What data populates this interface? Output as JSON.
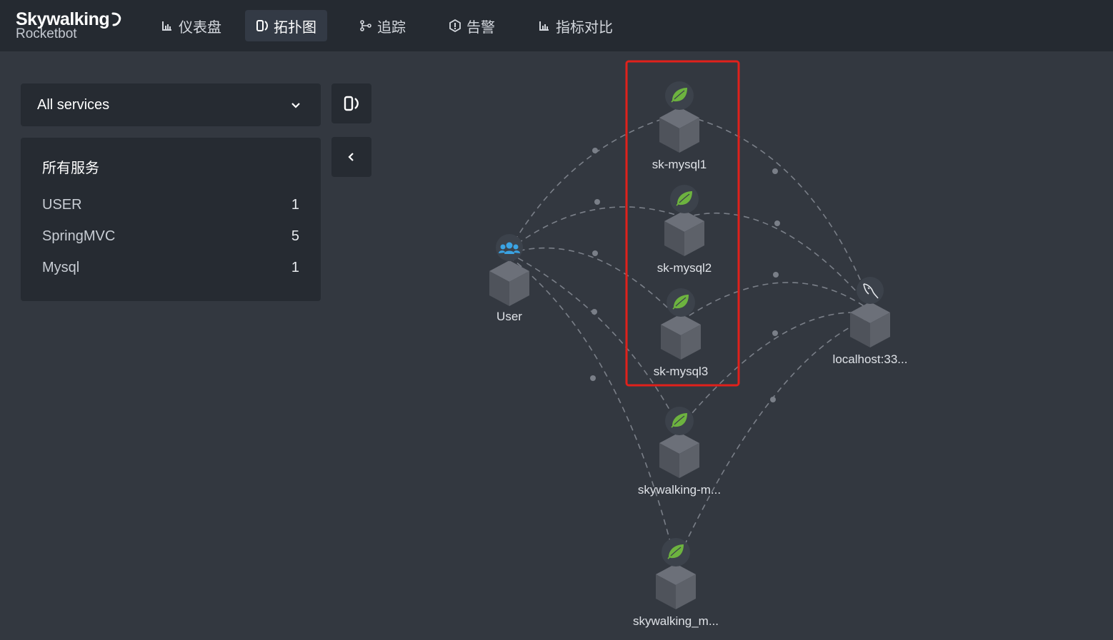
{
  "app": {
    "brand": "Skywalking",
    "subtitle": "Rocketbot"
  },
  "nav": [
    {
      "label": "仪表盘",
      "icon": "dashboard-chart-icon",
      "active": false
    },
    {
      "label": "拓扑图",
      "icon": "topology-icon",
      "active": true
    },
    {
      "label": "追踪",
      "icon": "trace-branch-icon",
      "active": false
    },
    {
      "label": "告警",
      "icon": "alarm-icon",
      "active": false
    },
    {
      "label": "指标对比",
      "icon": "comparison-chart-icon",
      "active": false
    }
  ],
  "service_select": {
    "value": "All services",
    "icon": "chevron-down-icon"
  },
  "service_panel": {
    "title": "所有服务",
    "rows": [
      {
        "type": "USER",
        "count": "1"
      },
      {
        "type": "SpringMVC",
        "count": "5"
      },
      {
        "type": "Mysql",
        "count": "1"
      }
    ]
  },
  "side_buttons": {
    "topology_icon": "topology-icon",
    "collapse_icon": "chevron-left-icon"
  },
  "topology": {
    "nodes": [
      {
        "id": "user",
        "label": "User",
        "kind": "USER",
        "icon": "users-icon"
      },
      {
        "id": "m1",
        "label": "sk-mysql1",
        "kind": "SpringMVC",
        "icon": "spring-leaf-icon"
      },
      {
        "id": "m2",
        "label": "sk-mysql2",
        "kind": "SpringMVC",
        "icon": "spring-leaf-icon"
      },
      {
        "id": "m3",
        "label": "sk-mysql3",
        "kind": "SpringMVC",
        "icon": "spring-leaf-icon"
      },
      {
        "id": "sw1",
        "label": "skywalking-m...",
        "kind": "SpringMVC",
        "icon": "spring-leaf-icon"
      },
      {
        "id": "sw2",
        "label": "skywalking_m...",
        "kind": "SpringMVC",
        "icon": "spring-leaf-icon"
      },
      {
        "id": "db",
        "label": "localhost:33...",
        "kind": "Mysql",
        "icon": "mysql-dolphin-icon"
      }
    ],
    "edges": [
      {
        "from": "user",
        "to": "m1"
      },
      {
        "from": "user",
        "to": "m2"
      },
      {
        "from": "user",
        "to": "m3"
      },
      {
        "from": "user",
        "to": "sw1"
      },
      {
        "from": "user",
        "to": "sw2"
      },
      {
        "from": "m1",
        "to": "db"
      },
      {
        "from": "m2",
        "to": "db"
      },
      {
        "from": "m3",
        "to": "db"
      },
      {
        "from": "sw1",
        "to": "db"
      },
      {
        "from": "sw2",
        "to": "db"
      }
    ],
    "highlight_group": [
      "m1",
      "m2",
      "m3"
    ],
    "colors": {
      "highlight_box": "#e0211b",
      "spring_leaf": "#6db33f",
      "user_icon": "#3aa3e3",
      "edge": "#7a7f88"
    }
  }
}
